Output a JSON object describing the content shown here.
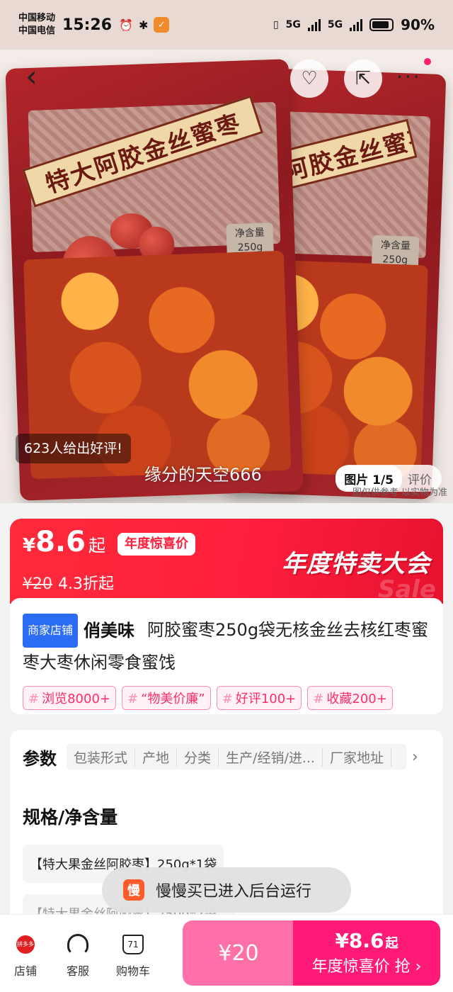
{
  "status_bar": {
    "carrier_1": "中国移动",
    "carrier_2": "中国电信",
    "time": "15:26",
    "network_1": "5G",
    "network_2": "5G",
    "battery": "90%"
  },
  "hero": {
    "bag_title": "特大阿胶金丝蜜枣",
    "net_weight_label": "净含量",
    "net_weight_value": "250g",
    "review_summary": "623人给出好评!",
    "watermark": "缘分的天空666",
    "image_index": "图片 1/5",
    "reviews_tab": "评价",
    "disclaimer": "图仅供参考 以实物为准"
  },
  "price": {
    "currency": "¥",
    "current": "8.6",
    "suffix": "起",
    "promo_badge": "年度惊喜价",
    "original": "¥20",
    "discount": "4.3折起",
    "event_title": "年度特卖大会",
    "deco": "Sale"
  },
  "product": {
    "store_tag": "商家店铺",
    "store_name": "俏美味",
    "title": "阿胶蜜枣250g袋无核金丝去核红枣蜜枣大枣休闲零食蜜饯",
    "tags": [
      "浏览8000+",
      "“物美价廉”",
      "好评100+",
      "收藏200+"
    ]
  },
  "params": {
    "label": "参数",
    "items": [
      "包装形式",
      "产地",
      "分类",
      "生产/经销/进...",
      "厂家地址"
    ],
    "spec_title": "规格/净含量",
    "spec_options": [
      "【特大果金丝阿胶枣】250g*1袋",
      "【特大果金丝阿胶枣】250g*2袋"
    ]
  },
  "toast": {
    "icon_text": "慢",
    "message": "慢慢买已进入后台运行"
  },
  "bottom_bar": {
    "store": "店铺",
    "store_icon_text": "拼多多",
    "service": "客服",
    "cart": "购物车",
    "cart_count": "71",
    "buy_left_price": "¥20",
    "buy_right_price": "¥8.6",
    "buy_right_suffix": "起",
    "buy_right_label": "年度惊喜价 抢"
  },
  "colors": {
    "accent": "#ff1f3d",
    "buy_pink": "#ff1a78",
    "buy_pink_light": "#ff6fa8",
    "store_tag_blue": "#2b6cf5"
  }
}
